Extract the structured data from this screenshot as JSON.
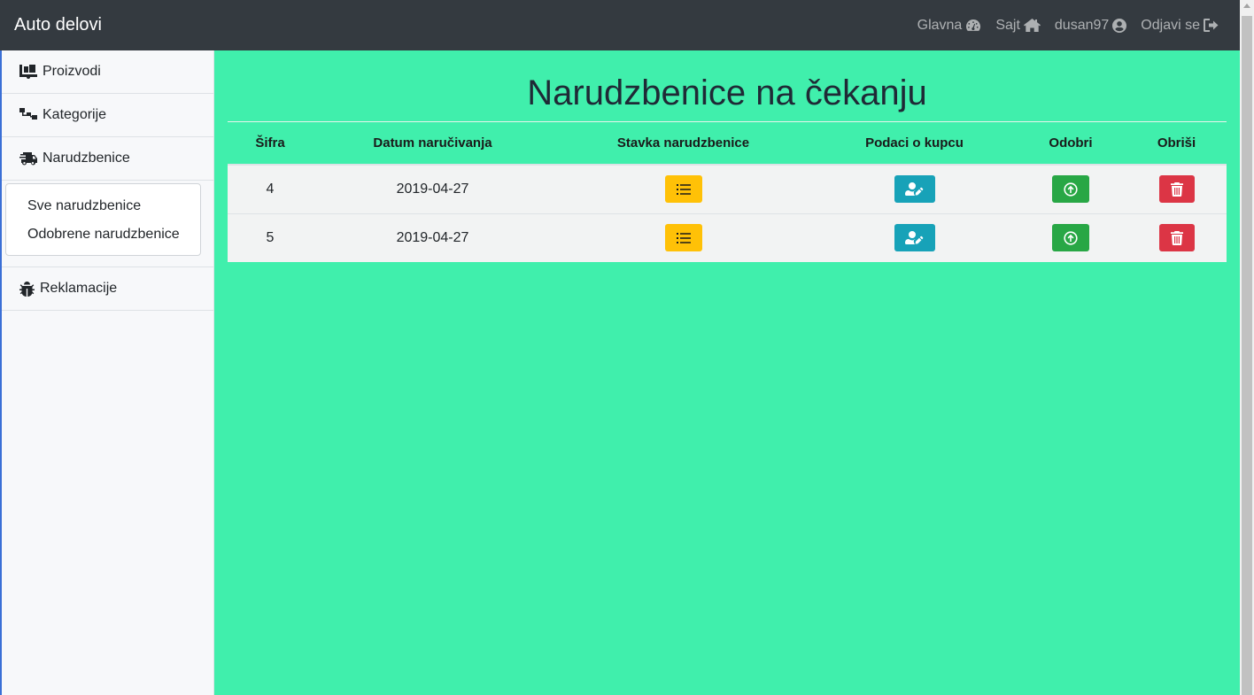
{
  "navbar": {
    "brand": "Auto delovi",
    "links": [
      {
        "label": "Glavna",
        "icon": "dashboard-icon"
      },
      {
        "label": "Sajt",
        "icon": "home-icon"
      },
      {
        "label": "dusan97",
        "icon": "user-circle-icon"
      },
      {
        "label": "Odjavi se",
        "icon": "sign-out-icon"
      }
    ]
  },
  "sidebar": {
    "items": [
      {
        "label": "Proizvodi",
        "icon": "dolly-icon"
      },
      {
        "label": "Kategorije",
        "icon": "sitemap-icon"
      },
      {
        "label": "Narudzbenice",
        "icon": "shipping-fast-icon"
      },
      {
        "label": "Reklamacije",
        "icon": "bug-icon"
      }
    ],
    "dropdown": [
      "Sve narudzbenice",
      "Odobrene narudzbenice"
    ]
  },
  "main": {
    "title": "Narudzbenice na čekanju",
    "columns": [
      "Šifra",
      "Datum naručivanja",
      "Stavka narudzbenice",
      "Podaci o kupcu",
      "Odobri",
      "Obriši"
    ],
    "rows": [
      {
        "id": "4",
        "date": "2019-04-27"
      },
      {
        "id": "5",
        "date": "2019-04-27"
      }
    ]
  },
  "colors": {
    "navbar": "#343a40",
    "main_bg": "#40efac",
    "warning": "#ffc107",
    "info": "#17a2b8",
    "success": "#28a745",
    "danger": "#dc3545"
  }
}
